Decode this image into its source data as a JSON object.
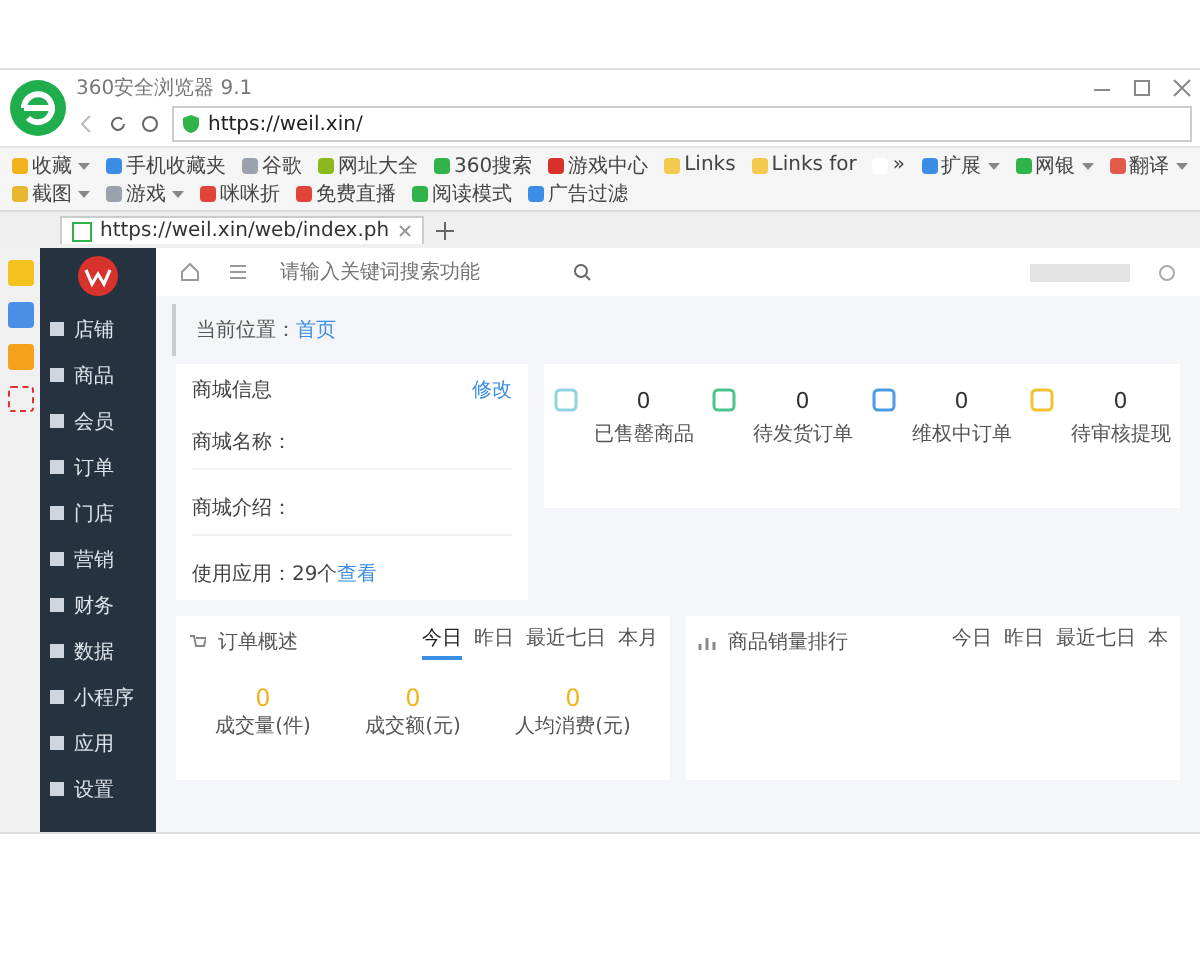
{
  "browser": {
    "title": "360安全浏览器 9.1",
    "address": "https://weil.xin/",
    "bookmarks": [
      {
        "label": "收藏",
        "dropdown": true,
        "color": "#f2b21c"
      },
      {
        "label": "手机收藏夹",
        "dropdown": false,
        "color": "#3a8ee6"
      },
      {
        "label": "谷歌",
        "dropdown": false,
        "color": "#9aa3ad"
      },
      {
        "label": "网址大全",
        "dropdown": false,
        "color": "#8bb81c"
      },
      {
        "label": "360搜索",
        "dropdown": false,
        "color": "#2fb34a"
      },
      {
        "label": "游戏中心",
        "dropdown": false,
        "color": "#d9302c"
      },
      {
        "label": "Links",
        "dropdown": false,
        "color": "#f2c94c"
      },
      {
        "label": "Links for",
        "dropdown": false,
        "color": "#f2c94c"
      },
      {
        "label": "»",
        "dropdown": false,
        "color": "#ffffff"
      },
      {
        "label": "扩展",
        "dropdown": true,
        "color": "#3a8ee6"
      },
      {
        "label": "网银",
        "dropdown": true,
        "color": "#2fb34a"
      },
      {
        "label": "翻译",
        "dropdown": true,
        "color": "#e25a4a"
      },
      {
        "label": "截图",
        "dropdown": true,
        "color": "#e8b730"
      },
      {
        "label": "游戏",
        "dropdown": true,
        "color": "#9aa3ad"
      },
      {
        "label": "咪咪折",
        "dropdown": false,
        "color": "#e2443a"
      },
      {
        "label": "免费直播",
        "dropdown": false,
        "color": "#e2443a"
      },
      {
        "label": "阅读模式",
        "dropdown": false,
        "color": "#2fb34a"
      },
      {
        "label": "广告过滤",
        "dropdown": false,
        "color": "#3a8ee6"
      }
    ],
    "tab": {
      "title": "https://weil.xin/web/index.ph"
    }
  },
  "admin": {
    "nav": [
      {
        "label": "店铺"
      },
      {
        "label": "商品"
      },
      {
        "label": "会员"
      },
      {
        "label": "订单"
      },
      {
        "label": "门店"
      },
      {
        "label": "营销"
      },
      {
        "label": "财务"
      },
      {
        "label": "数据"
      },
      {
        "label": "小程序"
      },
      {
        "label": "应用"
      },
      {
        "label": "设置"
      }
    ],
    "search_placeholder": "请输入关键词搜索功能",
    "breadcrumb": {
      "label": "当前位置：",
      "current": "首页"
    },
    "shop_card": {
      "title": "商城信息",
      "edit": "修改",
      "fields": [
        "商城名称：",
        "商城介绍："
      ],
      "apps": "使用应用：29个",
      "apps_link": "查看"
    },
    "stats": [
      {
        "value": "0",
        "label": "已售罄商品",
        "color": "#8fd3e0"
      },
      {
        "value": "0",
        "label": "待发货订单",
        "color": "#4cc38a"
      },
      {
        "value": "0",
        "label": "维权中订单",
        "color": "#4a9be8"
      },
      {
        "value": "0",
        "label": "待审核提现",
        "color": "#f2c230"
      }
    ],
    "orders": {
      "title": "订单概述",
      "tabs": [
        {
          "label": "今日",
          "selected": true
        },
        {
          "label": "昨日",
          "selected": false
        },
        {
          "label": "最近七日",
          "selected": false
        },
        {
          "label": "本月",
          "selected": false
        }
      ],
      "metrics": [
        {
          "value": "0",
          "label": "成交量(件)"
        },
        {
          "value": "0",
          "label": "成交额(元)"
        },
        {
          "value": "0",
          "label": "人均消费(元)"
        }
      ]
    },
    "ranking": {
      "title": "商品销量排行",
      "tabs": [
        {
          "label": "今日",
          "selected": false
        },
        {
          "label": "昨日",
          "selected": false
        },
        {
          "label": "最近七日",
          "selected": false
        },
        {
          "label": "本",
          "selected": false
        }
      ]
    }
  }
}
